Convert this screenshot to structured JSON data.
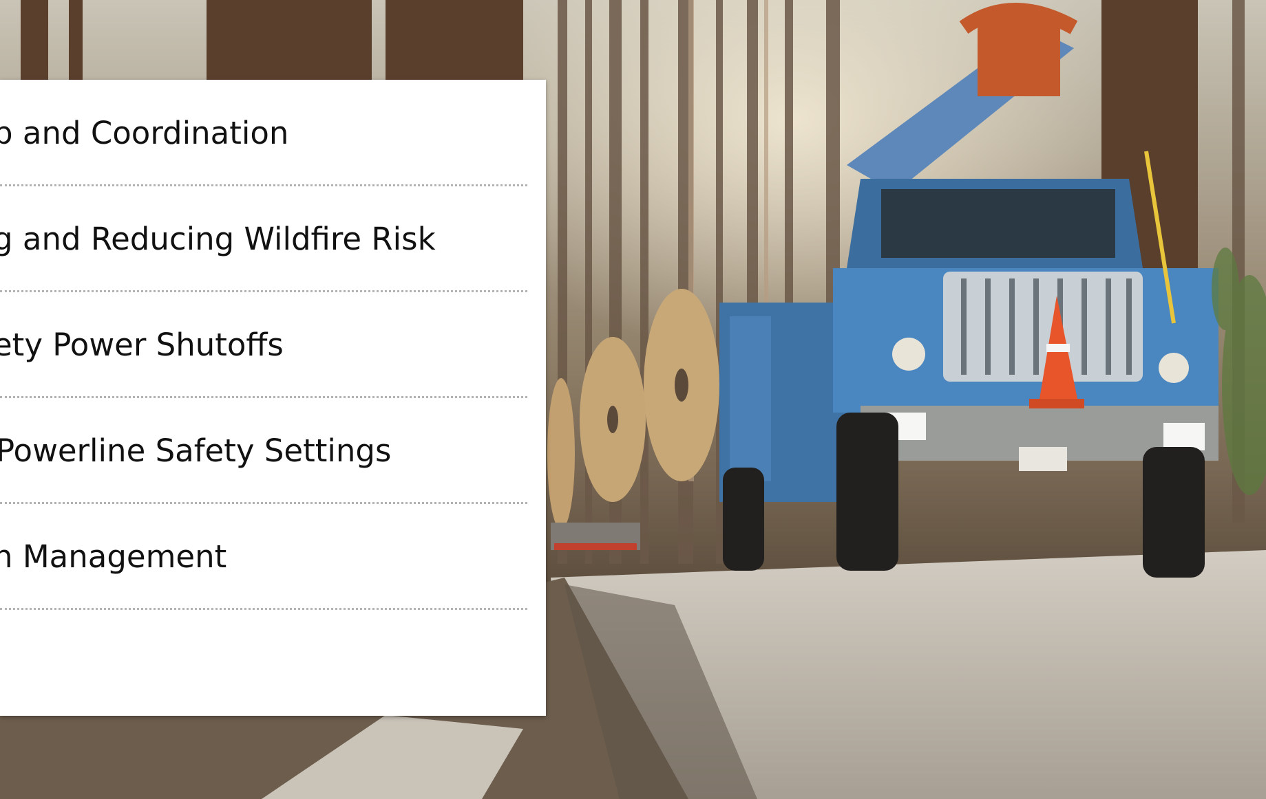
{
  "slide": {
    "background_image": "utility-truck-on-forest-road-photo",
    "agenda": {
      "items": [
        {
          "label": "p and Coordination"
        },
        {
          "label": "g and Reducing Wildfire Risk"
        },
        {
          "label": "ety Power Shutoffs"
        },
        {
          "label": "Powerline Safety Settings"
        },
        {
          "label": "n Management"
        }
      ]
    }
  },
  "colors": {
    "card_background": "#ffffff",
    "text": "#111111",
    "divider": "#b3b3b3",
    "truck_body": "#3f73a6",
    "cone": "#e8552a"
  }
}
